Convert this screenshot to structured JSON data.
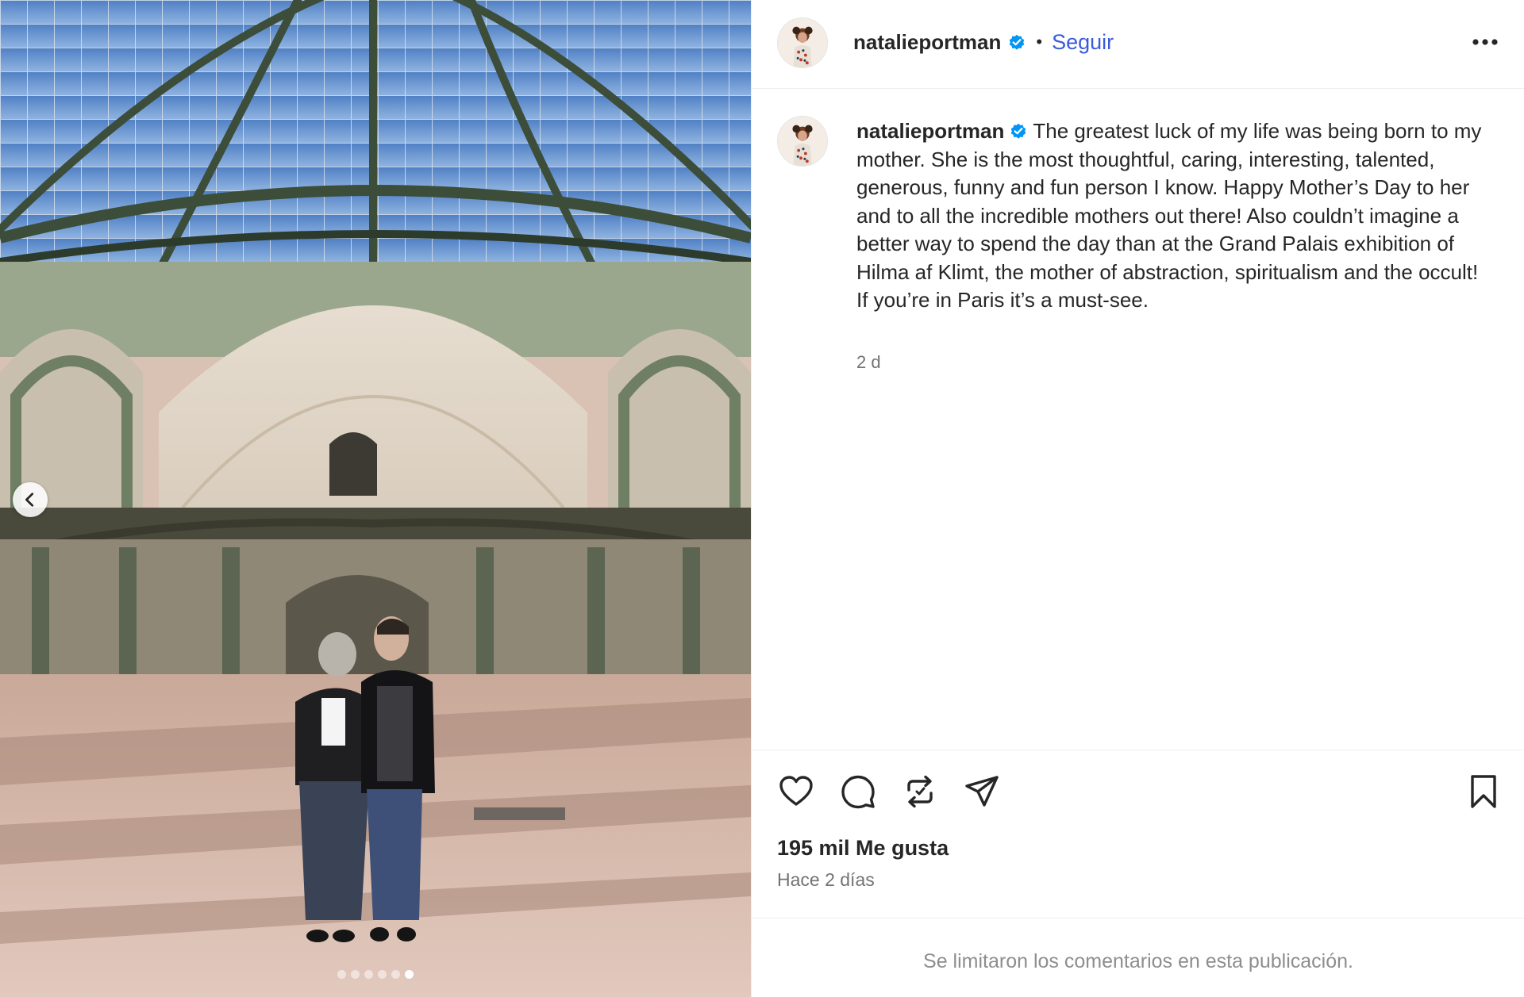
{
  "post": {
    "username": "natalieportman",
    "follow_label": "Seguir",
    "separator": "•",
    "caption": "The greatest luck of my life was being born to my mother. She is the most thoughtful, caring, interesting, talented, generous, funny and fun person I know. Happy Mother’s Day to her and to all the incredible mothers out there! Also couldn’t imagine a better way to spend the day than at the Grand Palais exhibition of Hilma af Klimt, the mother of abstraction, spiritualism and the occult! If you’re in Paris it’s a must-see.",
    "caption_age": "2 d",
    "likes": "195 mil Me gusta",
    "date": "Hace 2 días",
    "comments_notice": "Se limitaron los comentarios en esta publicación."
  },
  "carousel": {
    "total_slides": 6,
    "active_slide": 6
  },
  "icons": {
    "verified": "verified-badge-icon",
    "more": "more-options-icon",
    "prev": "chevron-left-icon",
    "like": "heart-icon",
    "comment": "comment-icon",
    "repost": "repost-icon",
    "share": "share-icon",
    "save": "bookmark-icon"
  },
  "colors": {
    "accent": "#3b5bdb",
    "verified": "#0095f6",
    "text": "#262626",
    "muted": "#737373"
  }
}
